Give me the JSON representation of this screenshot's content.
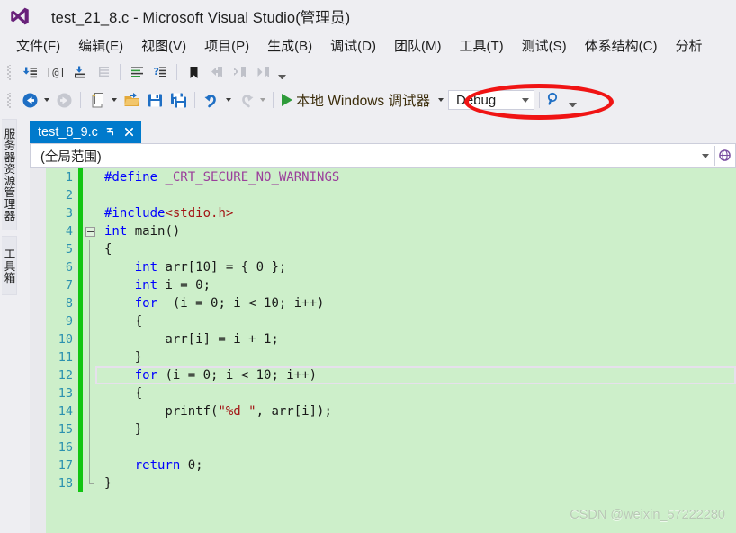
{
  "window": {
    "title": "test_21_8.c - Microsoft Visual Studio(管理员)",
    "logo_icon": "visual-studio-logo"
  },
  "menubar": {
    "items": [
      {
        "label": "文件(F)"
      },
      {
        "label": "编辑(E)"
      },
      {
        "label": "视图(V)"
      },
      {
        "label": "项目(P)"
      },
      {
        "label": "生成(B)"
      },
      {
        "label": "调试(D)"
      },
      {
        "label": "团队(M)"
      },
      {
        "label": "工具(T)"
      },
      {
        "label": "测试(S)"
      },
      {
        "label": "体系结构(C)"
      },
      {
        "label": "分析"
      }
    ]
  },
  "toolbar_text": {
    "row1_icons": [
      "comment-selection-icon",
      "uncomment-at-icon",
      "increase-indent-icon",
      "decrease-indent-icon",
      "format-document-icon",
      "format-selection-icon",
      "toggle-bookmark-icon",
      "previous-bookmark-icon",
      "next-bookmark-icon",
      "clear-bookmarks-icon"
    ],
    "row2_icons": [
      "navigate-backward-icon",
      "navigate-forward-icon",
      "new-file-icon",
      "open-file-icon",
      "save-icon",
      "save-all-icon",
      "undo-icon",
      "redo-icon"
    ]
  },
  "debug_toolbar": {
    "start_label": "本地 Windows 调试器",
    "play_icon": "play-triangle-icon",
    "configuration": "Debug",
    "search_icon": "search-icon",
    "overflow_icon": "toolbar-overflow-icon"
  },
  "annotation": {
    "shape": "ellipse",
    "color": "#F01414",
    "targets": "Debug"
  },
  "left_dock": {
    "tabs": [
      {
        "label": "服务器资源管理器"
      },
      {
        "label": "工具箱"
      }
    ]
  },
  "editor": {
    "tab": {
      "name": "test_8_9.c",
      "pin_icon": "pin-icon",
      "close_icon": "close-icon"
    },
    "navigation_bar": {
      "scope": "(全局范围)",
      "dropdown_icon": "chevron-down-icon",
      "end_icon": "globe-icon"
    },
    "current_line": 12,
    "lines": [
      {
        "n": 1,
        "segs": [
          {
            "t": "#define ",
            "c": "pre"
          },
          {
            "t": "_CRT_SECURE_NO_WARNINGS",
            "c": "mac"
          }
        ],
        "fold": "none"
      },
      {
        "n": 2,
        "segs": [],
        "fold": "none"
      },
      {
        "n": 3,
        "segs": [
          {
            "t": "#include",
            "c": "pre"
          },
          {
            "t": "<stdio.h>",
            "c": "inc"
          }
        ],
        "fold": "none"
      },
      {
        "n": 4,
        "segs": [
          {
            "t": "int",
            "c": "kw"
          },
          {
            "t": " main()",
            "c": ""
          }
        ],
        "fold": "box"
      },
      {
        "n": 5,
        "segs": [
          {
            "t": "{",
            "c": ""
          }
        ],
        "fold": "line"
      },
      {
        "n": 6,
        "segs": [
          {
            "t": "    ",
            "c": ""
          },
          {
            "t": "int",
            "c": "kw"
          },
          {
            "t": " arr[10] = { 0 };",
            "c": ""
          }
        ],
        "fold": "line"
      },
      {
        "n": 7,
        "segs": [
          {
            "t": "    ",
            "c": ""
          },
          {
            "t": "int",
            "c": "kw"
          },
          {
            "t": " i = 0;",
            "c": ""
          }
        ],
        "fold": "line"
      },
      {
        "n": 8,
        "segs": [
          {
            "t": "    ",
            "c": ""
          },
          {
            "t": "for",
            "c": "kw"
          },
          {
            "t": "  (i = 0; i < 10; i++)",
            "c": ""
          }
        ],
        "fold": "line"
      },
      {
        "n": 9,
        "segs": [
          {
            "t": "    {",
            "c": ""
          }
        ],
        "fold": "line"
      },
      {
        "n": 10,
        "segs": [
          {
            "t": "        arr[i] = i + 1;",
            "c": ""
          }
        ],
        "fold": "line"
      },
      {
        "n": 11,
        "segs": [
          {
            "t": "    }",
            "c": ""
          }
        ],
        "fold": "line"
      },
      {
        "n": 12,
        "segs": [
          {
            "t": "    ",
            "c": ""
          },
          {
            "t": "for",
            "c": "kw"
          },
          {
            "t": " (i = 0; i < 10; i++)",
            "c": ""
          }
        ],
        "fold": "line"
      },
      {
        "n": 13,
        "segs": [
          {
            "t": "    {",
            "c": ""
          }
        ],
        "fold": "line"
      },
      {
        "n": 14,
        "segs": [
          {
            "t": "        printf(",
            "c": ""
          },
          {
            "t": "\"%d \"",
            "c": "str"
          },
          {
            "t": ", arr[i]);",
            "c": ""
          }
        ],
        "fold": "line"
      },
      {
        "n": 15,
        "segs": [
          {
            "t": "    }",
            "c": ""
          }
        ],
        "fold": "line"
      },
      {
        "n": 16,
        "segs": [],
        "fold": "line"
      },
      {
        "n": 17,
        "segs": [
          {
            "t": "    ",
            "c": ""
          },
          {
            "t": "return",
            "c": "kw"
          },
          {
            "t": " 0;",
            "c": ""
          }
        ],
        "fold": "line"
      },
      {
        "n": 18,
        "segs": [
          {
            "t": "}",
            "c": ""
          }
        ],
        "fold": "end"
      }
    ]
  },
  "watermark": {
    "text": "CSDN @weixin_57222280"
  }
}
